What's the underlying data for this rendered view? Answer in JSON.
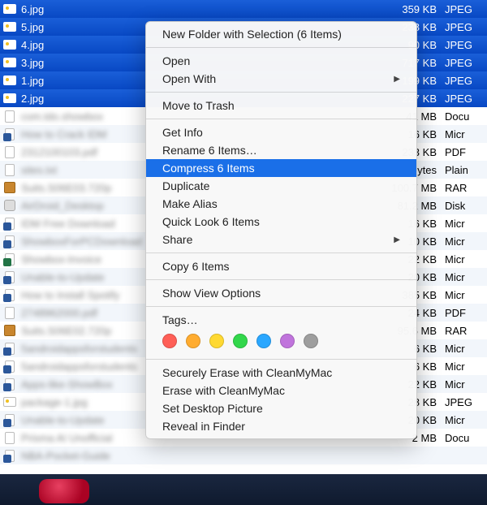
{
  "files": [
    {
      "name": "6.jpg",
      "size": "359 KB",
      "kind": "JPEG",
      "selected": true,
      "icon": "image",
      "blur": false
    },
    {
      "name": "5.jpg",
      "size": "238 KB",
      "kind": "JPEG",
      "selected": true,
      "icon": "image",
      "blur": false
    },
    {
      "name": "4.jpg",
      "size": "90 KB",
      "kind": "JPEG",
      "selected": true,
      "icon": "image",
      "blur": false
    },
    {
      "name": "3.jpg",
      "size": "717 KB",
      "kind": "JPEG",
      "selected": true,
      "icon": "image",
      "blur": false
    },
    {
      "name": "1.jpg",
      "size": "199 KB",
      "kind": "JPEG",
      "selected": true,
      "icon": "image",
      "blur": false
    },
    {
      "name": "2.jpg",
      "size": "227 KB",
      "kind": "JPEG",
      "selected": true,
      "icon": "image",
      "blur": false
    },
    {
      "name": "com.tdo.showbox",
      "size": "41 MB",
      "kind": "Docu",
      "selected": false,
      "icon": "doc",
      "blur": true
    },
    {
      "name": "How to Crack IDM",
      "size": "16 KB",
      "kind": "Micr",
      "selected": false,
      "icon": "word",
      "blur": true
    },
    {
      "name": "2312100103.pdf",
      "size": "233 KB",
      "kind": "PDF",
      "selected": false,
      "icon": "pdf",
      "blur": true
    },
    {
      "name": "sites.txt",
      "size": "95 bytes",
      "kind": "Plain",
      "selected": false,
      "icon": "txt",
      "blur": true
    },
    {
      "name": "Suits.S06E03.720p",
      "size": "100.7 MB",
      "kind": "RAR",
      "selected": false,
      "icon": "rar",
      "blur": true
    },
    {
      "name": "AirDroid_Desktop",
      "size": "81.2 MB",
      "kind": "Disk",
      "selected": false,
      "icon": "dmg",
      "blur": true
    },
    {
      "name": "IDM Free Download",
      "size": "16 KB",
      "kind": "Micr",
      "selected": false,
      "icon": "word",
      "blur": true
    },
    {
      "name": "ShowboxForPCDownload",
      "size": "10 KB",
      "kind": "Micr",
      "selected": false,
      "icon": "word",
      "blur": true
    },
    {
      "name": "Showbox-Invoice",
      "size": "22 KB",
      "kind": "Micr",
      "selected": false,
      "icon": "excel",
      "blur": true
    },
    {
      "name": "Unable-to-Update",
      "size": "20 KB",
      "kind": "Micr",
      "selected": false,
      "icon": "word",
      "blur": true
    },
    {
      "name": "How to Install Spotify",
      "size": "385 KB",
      "kind": "Micr",
      "selected": false,
      "icon": "word",
      "blur": true
    },
    {
      "name": "2748962000.pdf",
      "size": "24 KB",
      "kind": "PDF",
      "selected": false,
      "icon": "pdf",
      "blur": true
    },
    {
      "name": "Suits.S06E02.720p",
      "size": "95.6 MB",
      "kind": "RAR",
      "selected": false,
      "icon": "rar",
      "blur": true
    },
    {
      "name": "5androidappsforstudents",
      "size": "6 KB",
      "kind": "Micr",
      "selected": false,
      "icon": "word",
      "blur": true
    },
    {
      "name": "5androidappsforstudents",
      "size": "6 KB",
      "kind": "Micr",
      "selected": false,
      "icon": "word",
      "blur": true
    },
    {
      "name": "Apps-like-ShowBox",
      "size": "22 KB",
      "kind": "Micr",
      "selected": false,
      "icon": "word",
      "blur": true
    },
    {
      "name": "package-1.jpg",
      "size": "28 KB",
      "kind": "JPEG",
      "selected": false,
      "icon": "image",
      "blur": true
    },
    {
      "name": "Unable-to-Update",
      "size": "20 KB",
      "kind": "Micr",
      "selected": false,
      "icon": "word",
      "blur": true
    },
    {
      "name": "Prisma AI Unofficial",
      "size": "2 MB",
      "kind": "Docu",
      "selected": false,
      "icon": "doc",
      "blur": true
    },
    {
      "name": "NBA-Pocket-Guide",
      "size": "",
      "kind": "",
      "selected": false,
      "icon": "word",
      "blur": true
    }
  ],
  "menu": {
    "new_folder": "New Folder with Selection (6 Items)",
    "open": "Open",
    "open_with": "Open With",
    "trash": "Move to Trash",
    "get_info": "Get Info",
    "rename": "Rename 6 Items…",
    "compress": "Compress 6 Items",
    "duplicate": "Duplicate",
    "make_alias": "Make Alias",
    "quick_look": "Quick Look 6 Items",
    "share": "Share",
    "copy": "Copy 6 Items",
    "view_options": "Show View Options",
    "tags": "Tags…",
    "secure_erase": "Securely Erase with CleanMyMac",
    "erase": "Erase with CleanMyMac",
    "set_desktop": "Set Desktop Picture",
    "reveal": "Reveal in Finder"
  },
  "tag_colors": [
    "#ff5f57",
    "#ffac30",
    "#ffd932",
    "#32d74b",
    "#2aa7ff",
    "#c074dc",
    "#9e9e9e"
  ]
}
